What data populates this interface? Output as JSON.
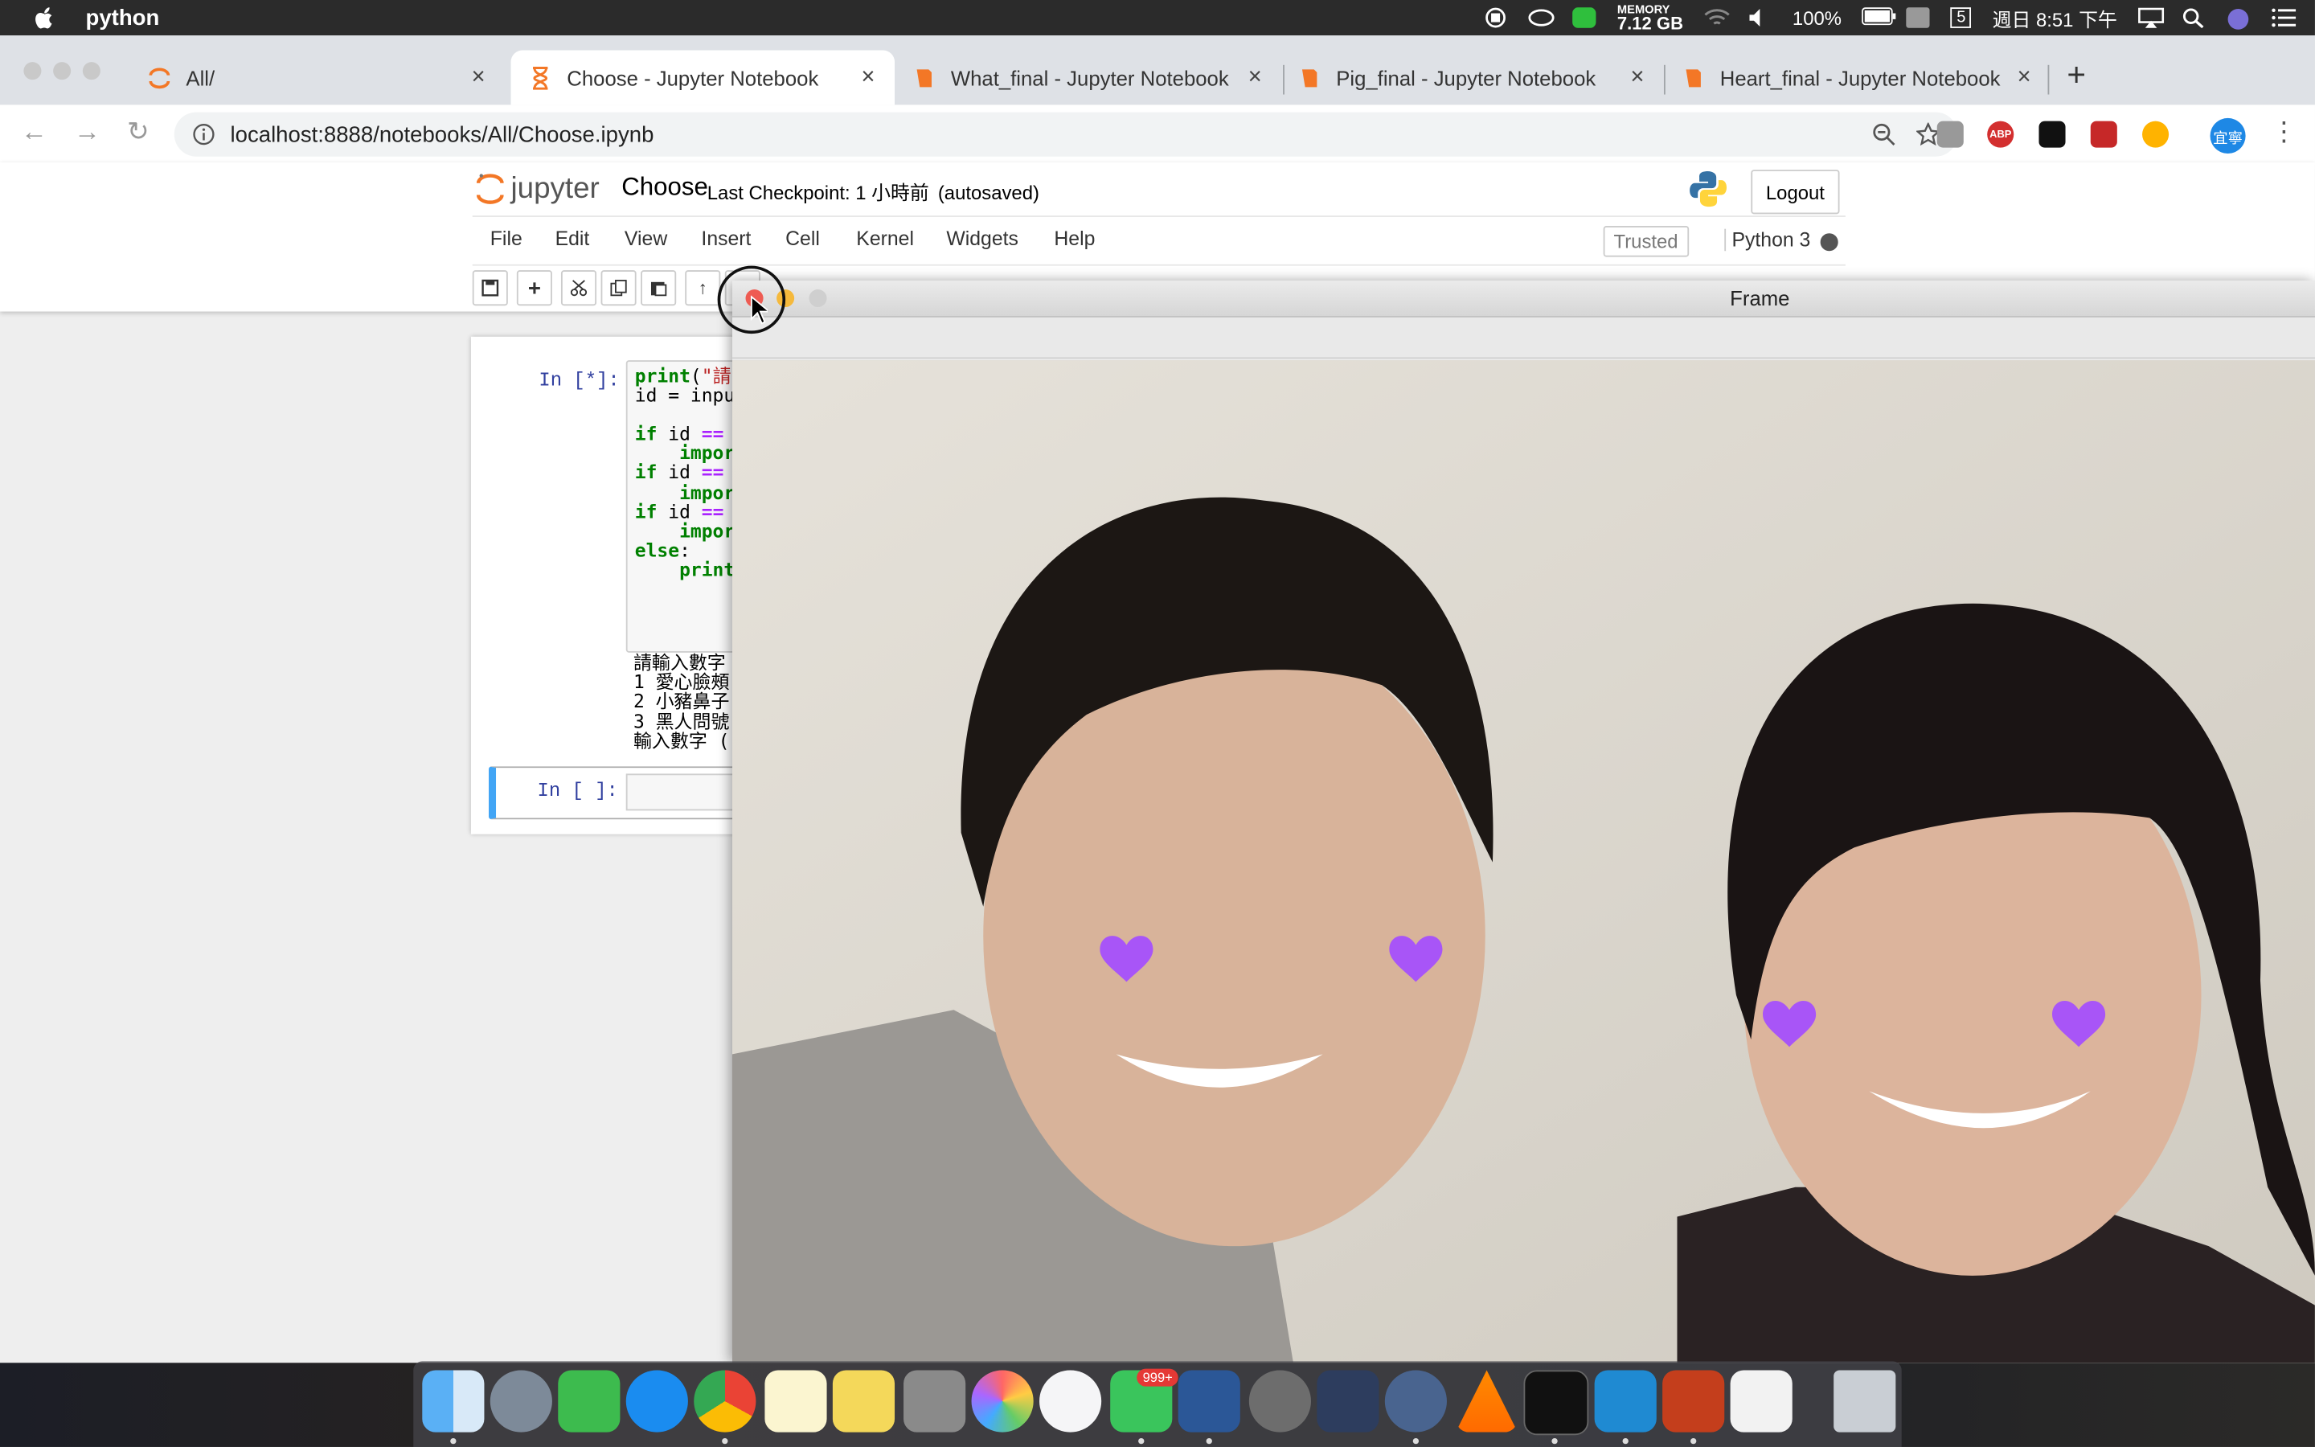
{
  "menubar": {
    "app_name": "python",
    "memory_label": "MEMORY",
    "memory_value": "7.12 GB",
    "battery": "100%",
    "date_badge": "5",
    "clock": "週日 8:51 下午"
  },
  "browser": {
    "tabs": [
      {
        "title": "All/"
      },
      {
        "title": "Choose - Jupyter Notebook"
      },
      {
        "title": "What_final - Jupyter Notebook"
      },
      {
        "title": "Pig_final - Jupyter Notebook"
      },
      {
        "title": "Heart_final - Jupyter Notebook"
      }
    ],
    "url": "localhost:8888/notebooks/All/Choose.ipynb",
    "profile": "宜寧",
    "ext_abp": "ABP"
  },
  "jupyter": {
    "logo_text": "jupyter",
    "notebook_name": "Choose",
    "checkpoint": "Last Checkpoint: 1 小時前",
    "autosave": "(autosaved)",
    "logout": "Logout",
    "menus": [
      "File",
      "Edit",
      "View",
      "Insert",
      "Cell",
      "Kernel",
      "Widgets",
      "Help"
    ],
    "trusted": "Trusted",
    "kernel": "Python 3",
    "cell1_prompt": "In [*]:",
    "code_lines": [
      "print(\"請",
      "id = inpu",
      "",
      "if id ==",
      "    impor",
      "if id ==",
      "    impor",
      "if id ==",
      "    impor",
      "else:",
      "    print"
    ],
    "output_lines": [
      "請輸入數字",
      "1 愛心臉頰",
      "2 小豬鼻子",
      "3 黑人問號",
      "輸入數字 (."
    ],
    "cell2_prompt": "In [ ]:"
  },
  "frame_window": {
    "title": "Frame"
  },
  "dock": {
    "line_badge": "999+"
  }
}
